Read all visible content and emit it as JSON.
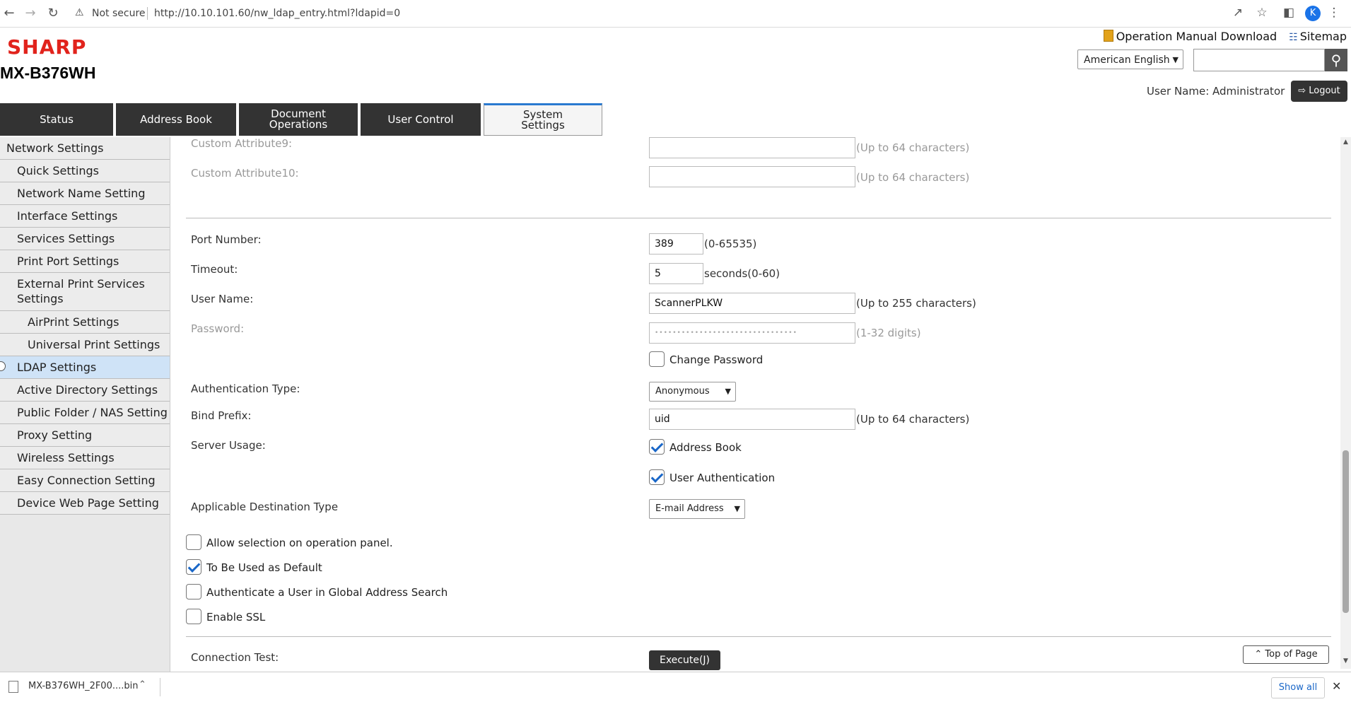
{
  "browser": {
    "not_secure": "Not secure",
    "url": "http://10.10.101.60/nw_ldap_entry.html?ldapid=0",
    "profile_initial": "K"
  },
  "header": {
    "brand": "SHARP",
    "model": "MX-B376WH",
    "manual_link": "Operation Manual Download",
    "sitemap_link": "Sitemap",
    "language": "American English",
    "search_placeholder": "",
    "user_name": "User Name: Administrator",
    "logout": "Logout"
  },
  "tabs": [
    {
      "label": "Status"
    },
    {
      "label": "Address Book"
    },
    {
      "label": "Document Operations"
    },
    {
      "label": "User Control"
    },
    {
      "label": "System Settings"
    }
  ],
  "sidebar": {
    "items": [
      {
        "label": "Network Settings"
      },
      {
        "label": "Quick Settings"
      },
      {
        "label": "Network Name Setting"
      },
      {
        "label": "Interface Settings"
      },
      {
        "label": "Services Settings"
      },
      {
        "label": "Print Port Settings"
      },
      {
        "label": "External Print Services Settings"
      },
      {
        "label": "AirPrint Settings"
      },
      {
        "label": "Universal Print Settings"
      },
      {
        "label": "LDAP Settings"
      },
      {
        "label": "Active Directory Settings"
      },
      {
        "label": "Public Folder / NAS Setting"
      },
      {
        "label": "Proxy Setting"
      },
      {
        "label": "Wireless Settings"
      },
      {
        "label": "Easy Connection Setting"
      },
      {
        "label": "Device Web Page Setting"
      }
    ]
  },
  "form": {
    "custom9": {
      "label": "Custom Attribute9:",
      "value": "",
      "hint": "(Up to 64 characters)"
    },
    "custom10": {
      "label": "Custom Attribute10:",
      "value": "",
      "hint": "(Up to 64 characters)"
    },
    "port": {
      "label": "Port Number:",
      "value": "389",
      "hint": "(0-65535)"
    },
    "timeout": {
      "label": "Timeout:",
      "value": "5",
      "hint": "seconds(0-60)"
    },
    "username": {
      "label": "User Name:",
      "value": "ScannerPLKW",
      "hint": "(Up to 255 characters)"
    },
    "password": {
      "label": "Password:",
      "value": "••••••••••••••••••••••••••••••••",
      "hint": "(1-32 digits)"
    },
    "change_password": {
      "label": "Change Password",
      "checked": false
    },
    "auth_type": {
      "label": "Authentication Type:",
      "value": "Anonymous"
    },
    "bind_prefix": {
      "label": "Bind Prefix:",
      "value": "uid",
      "hint": "(Up to 64 characters)"
    },
    "server_usage": {
      "label": "Server Usage:",
      "address_book": "Address Book",
      "user_auth": "User Authentication"
    },
    "dest_type": {
      "label": "Applicable Destination Type",
      "value": "E-mail Address"
    },
    "allow_selection": {
      "label": "Allow selection on operation panel.",
      "checked": false
    },
    "default": {
      "label": "To Be Used as Default",
      "checked": true
    },
    "auth_global": {
      "label": "Authenticate a User in Global Address Search",
      "checked": false
    },
    "ssl": {
      "label": "Enable SSL",
      "checked": false
    },
    "connection_test": {
      "label": "Connection Test:",
      "button": "Execute(J)"
    },
    "top_of_page": "Top of Page"
  },
  "downloads": {
    "file": "MX-B376WH_2F00....bin",
    "show_all": "Show all"
  }
}
